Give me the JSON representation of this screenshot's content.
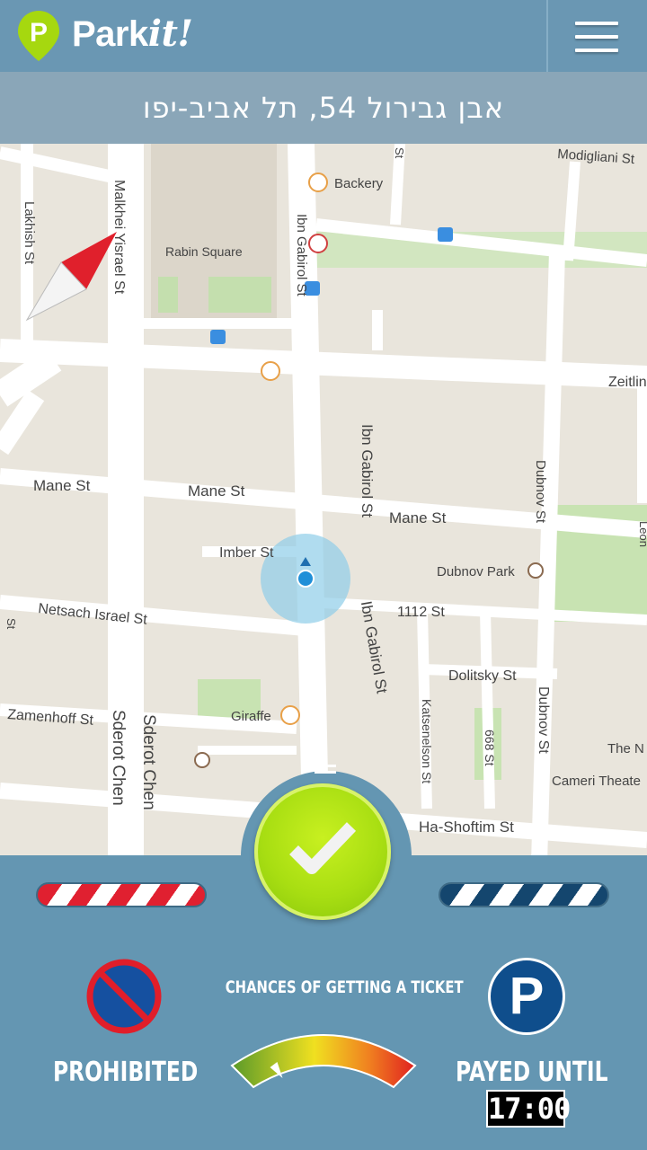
{
  "app": {
    "name_plain": "Park",
    "name_script": "it!",
    "logo_letter": "P",
    "menu_icon": "hamburger-menu-icon"
  },
  "address": {
    "text": "אבן גבירול 54, תל אביב-יפו"
  },
  "map": {
    "streets": [
      "Ibn Gabirol St",
      "Malkhei Yisrael St",
      "Lakhish St",
      "Mane St",
      "Imber St",
      "Netsach Israel St",
      "Zamenhoff St",
      "Sderot Chen",
      "Dubnov St",
      "1112 St",
      "Dolitsky St",
      "Katsenelson St",
      "668 St",
      "Ha-Shoftim St",
      "Zeitlin",
      "Modigliani St"
    ],
    "labels": {
      "ibn_top": "Ibn Gabirol St",
      "ibn_mid": "Ibn Gabirol St",
      "ibn_low": "Ibn Gabirol St",
      "malkhei": "Malkhei Yisrael St",
      "lakhish": "Lakhish St",
      "mane1": "Mane St",
      "mane2": "Mane St",
      "mane3": "Mane St",
      "imber": "Imber St",
      "netsach": "Netsach Israel St",
      "zamenhoff": "Zamenhoff St",
      "sderot1": "Sderot Chen",
      "sderot2": "Sderot Chen",
      "dubnov1": "Dubnov St",
      "dubnov2": "Dubnov St",
      "s1112": "1112 St",
      "dolitsky": "Dolitsky St",
      "katsenelson": "Katsenelson St",
      "s668": "668 St",
      "hashoftim": "Ha-Shoftim St",
      "zeitlin": "Zeitlin",
      "modigliani": "Modigliani St",
      "dubnov_park": "Dubnov Park",
      "rabin_square": "Rabin Square",
      "backery": "Backery",
      "giraffe": "Giraffe",
      "the_n": "The N",
      "cameri": "Cameri Theate",
      "leon": "Leon",
      "s_left": "St",
      "s_top": "St"
    }
  },
  "panel": {
    "prohibited": "PROHIBITED",
    "chances": "CHANCES OF GETTING A TICKET",
    "payed_until": "PAYED UNTIL",
    "time": "17:00",
    "parking_letter": "P",
    "confirm_icon": "checkmark-icon"
  },
  "colors": {
    "topbar": "#6a97b3",
    "address_bar": "#8aa6b8",
    "panel": "#6496b2",
    "confirm_green": "#a8de12",
    "prohibited_red": "#e02030",
    "payed_blue": "#14466e"
  },
  "gauge": {
    "level": 0.08
  }
}
